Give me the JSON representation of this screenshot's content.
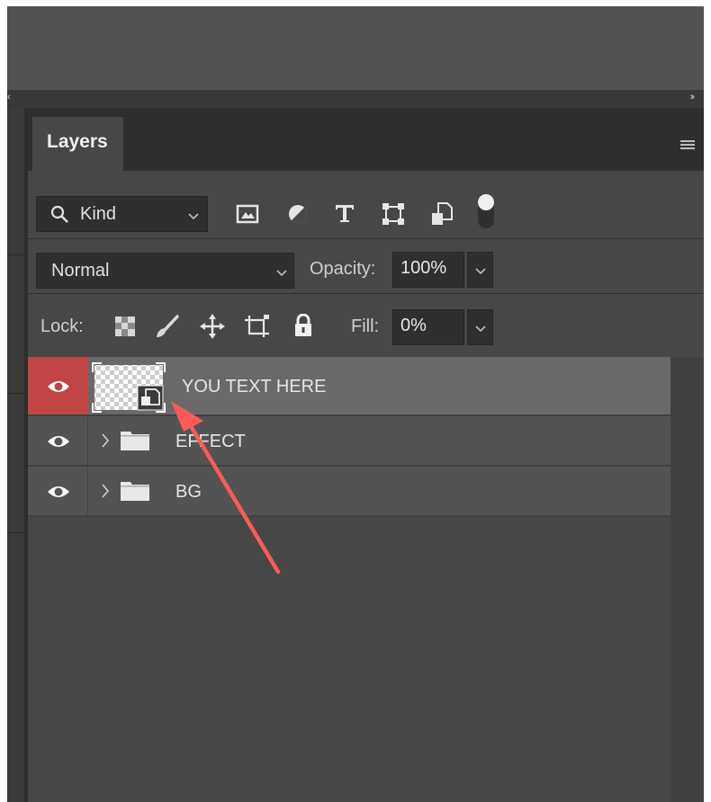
{
  "panel": {
    "tab_label": "Layers",
    "filter": {
      "kind_label": "Kind"
    },
    "blend_mode": "Normal",
    "opacity_label": "Opacity:",
    "opacity_value": "100%",
    "lock_label": "Lock:",
    "fill_label": "Fill:",
    "fill_value": "0%"
  },
  "layers": [
    {
      "name": "YOU TEXT HERE",
      "type": "smart-object",
      "selected": true,
      "visible": true
    },
    {
      "name": "EFFECT",
      "type": "group",
      "selected": false,
      "visible": true
    },
    {
      "name": "BG",
      "type": "group",
      "selected": false,
      "visible": true
    }
  ],
  "colors": {
    "panel_bg": "#474747",
    "selected_layer": "#696969",
    "eye_highlight": "#c14545",
    "annotation_arrow": "#ff5a5a"
  },
  "icons": [
    "search-icon",
    "image-filter-icon",
    "adjustment-filter-icon",
    "type-filter-icon",
    "shape-filter-icon",
    "smart-object-filter-icon",
    "filter-toggle-icon",
    "panel-menu-icon",
    "lock-transparent-icon",
    "lock-paint-icon",
    "lock-move-icon",
    "lock-artboard-icon",
    "lock-all-icon",
    "eye-icon",
    "folder-icon",
    "chevron-right-icon",
    "annotation-arrow"
  ]
}
